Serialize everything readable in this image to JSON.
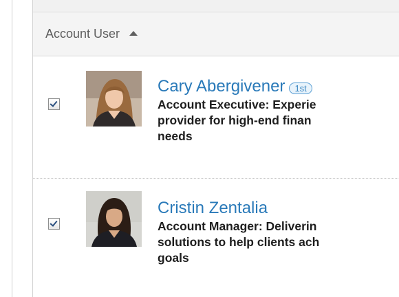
{
  "table": {
    "header": {
      "label": "Account User",
      "sort": "ascending"
    },
    "rows": [
      {
        "checked": true,
        "name": "Cary Abergivener",
        "degree": "1st",
        "headline": [
          "Account Executive: Experie",
          "provider for high-end finan",
          "needs"
        ]
      },
      {
        "checked": true,
        "name": "Cristin Zentalia",
        "degree": "",
        "headline": [
          "Account Manager: Deliverin",
          "solutions to help clients ach",
          "goals"
        ]
      }
    ]
  },
  "colors": {
    "link": "#2a7ab9",
    "header_bg": "#f4f4f4",
    "badge": "#3b86c1"
  }
}
